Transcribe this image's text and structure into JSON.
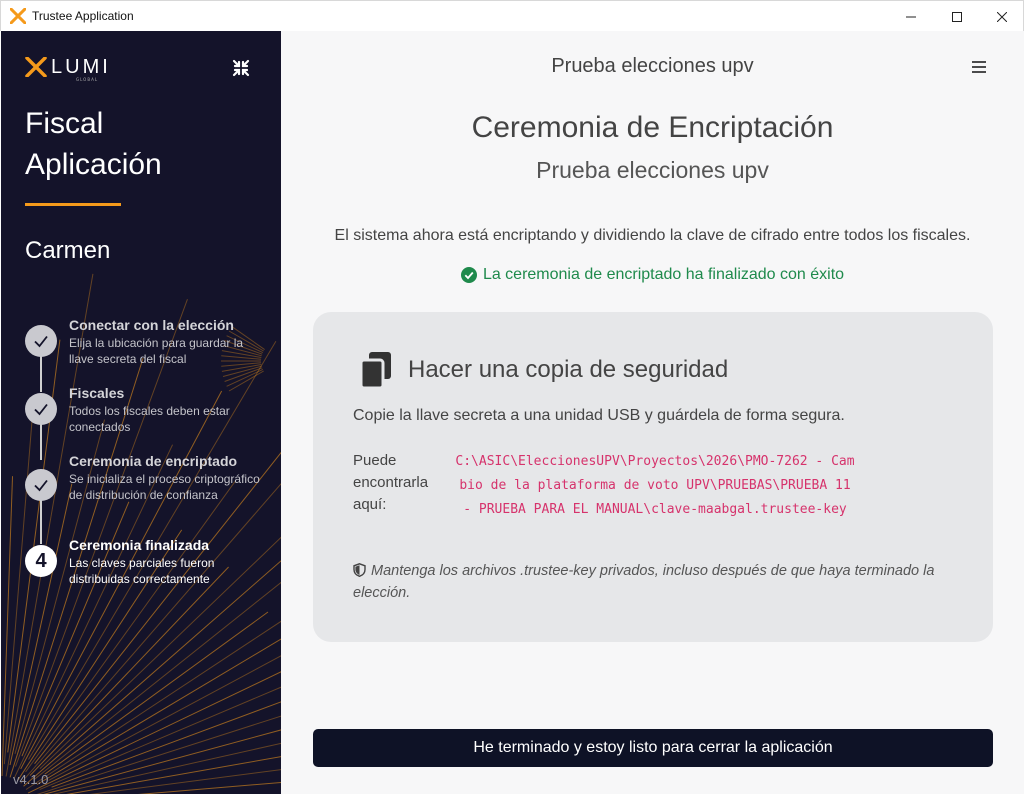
{
  "window": {
    "title": "Trustee Application"
  },
  "sidebar": {
    "logo_text": "LUMI",
    "logo_sub": "GLOBAL",
    "app_title_line1": "Fiscal",
    "app_title_line2": "Aplicación",
    "user_name": "Carmen",
    "accent_color": "#f59a1b",
    "steps": [
      {
        "title": "Conectar con la elección",
        "desc": "Elija la ubicación para guardar la llave secreta del fiscal",
        "status": "done"
      },
      {
        "title": "Fiscales",
        "desc": "Todos los fiscales deben estar conectados",
        "status": "done"
      },
      {
        "title": "Ceremonia de encriptado",
        "desc": "Se inicializa el proceso criptográfico de distribución de confianza",
        "status": "done"
      },
      {
        "title": "Ceremonia finalizada",
        "desc": "Las claves parciales fueron distribuidas correctamente",
        "status": "active",
        "number": "4"
      }
    ],
    "version": "v4.1.0"
  },
  "main": {
    "header_title": "Prueba elecciones upv",
    "heading": "Ceremonia de Encriptación",
    "subheading": "Prueba elecciones upv",
    "info_text": "El sistema ahora está encriptando y dividiendo la clave de cifrado entre todos los fiscales.",
    "success_text": "La ceremonia de encriptado ha finalizado con éxito",
    "success_color": "#1f8a4c",
    "card": {
      "title": "Hacer una copia de seguridad",
      "description": "Copie la llave secreta a una unidad USB y guárdela de forma segura.",
      "location_label": "Puede encontrarla aquí:",
      "path": "C:\\ASIC\\EleccionesUPV\\Proyectos\\2026\\PMO-7262 - Cambio de la plataforma de voto UPV\\PRUEBAS\\PRUEBA 11 - PRUEBA PARA EL MANUAL\\clave-maabgal.trustee-key",
      "note": "Mantenga los archivos .trustee-key privados, incluso después de que haya terminado la elección."
    },
    "finish_button": "He terminado y estoy listo para cerrar la aplicación"
  }
}
